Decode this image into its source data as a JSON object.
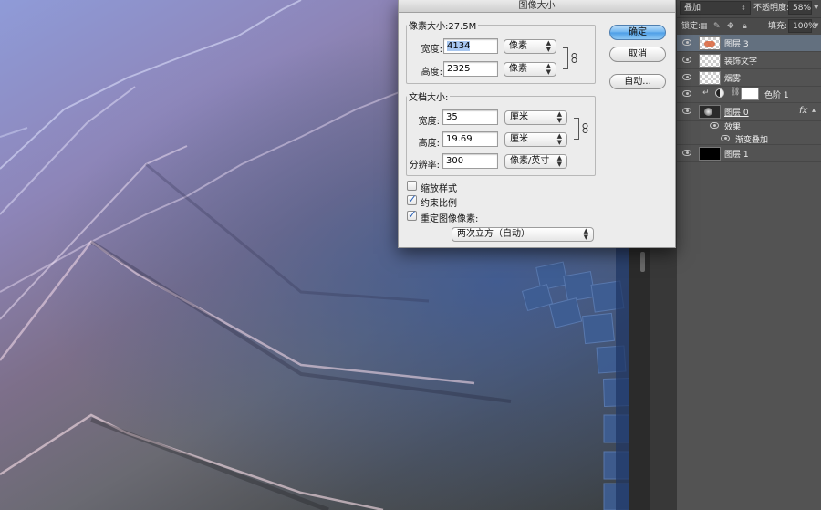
{
  "dialog": {
    "title": "图像大小",
    "pixel_dimensions": {
      "legend": "像素大小:27.5M",
      "width_label": "宽度:",
      "width_value": "4134",
      "width_unit": "像素",
      "height_label": "高度:",
      "height_value": "2325",
      "height_unit": "像素"
    },
    "document_size": {
      "legend": "文档大小:",
      "width_label": "宽度:",
      "width_value": "35",
      "width_unit": "厘米",
      "height_label": "高度:",
      "height_value": "19.69",
      "height_unit": "厘米",
      "resolution_label": "分辨率:",
      "resolution_value": "300",
      "resolution_unit": "像素/英寸"
    },
    "options": {
      "scale_styles": {
        "label": "缩放样式",
        "checked": false
      },
      "constrain_proportions": {
        "label": "约束比例",
        "checked": true
      },
      "resample": {
        "label": "重定图像像素:",
        "checked": true
      },
      "resample_method": "两次立方（自动）"
    },
    "buttons": {
      "ok": "确定",
      "cancel": "取消",
      "auto": "自动..."
    }
  },
  "layers_panel": {
    "blend_mode": "叠加",
    "opacity_label": "不透明度:",
    "opacity_value": "58%",
    "lock_label": "锁定:",
    "fill_label": "填充:",
    "fill_value": "100%",
    "layers": [
      {
        "name": "图层 3",
        "selected": true
      },
      {
        "name": "装饰文字",
        "selected": false
      },
      {
        "name": "烟雾",
        "selected": false
      },
      {
        "name": "色阶 1",
        "selected": false
      },
      {
        "name": "图层 0",
        "selected": false,
        "fx": "fx"
      },
      {
        "name": "效果",
        "selected": false
      },
      {
        "name": "渐变叠加",
        "selected": false
      },
      {
        "name": "图层 1",
        "selected": false
      }
    ]
  },
  "colors": {
    "selection_highlight": "#a8c7f0",
    "primary_button": "#4c9de6",
    "panel_bg": "#535353",
    "selected_layer": "#63707f"
  }
}
